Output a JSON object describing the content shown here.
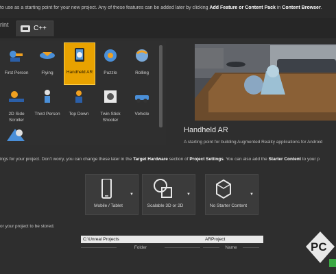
{
  "header": {
    "intro_prefix": "to use as a starting point for your new project.  Any of these features can be added later by clicking ",
    "add_feature": "Add Feature or Content Pack",
    "intro_mid": " in ",
    "content_browser": "Content Browser",
    "intro_suffix": "."
  },
  "tabs": {
    "blueprint_partial": "rint",
    "cpp": "C++"
  },
  "templates": [
    {
      "label": "First Person",
      "icon": "first-person-icon"
    },
    {
      "label": "Flying",
      "icon": "flying-icon"
    },
    {
      "label": "Handheld AR",
      "icon": "handheld-ar-icon",
      "selected": true
    },
    {
      "label": "Puzzle",
      "icon": "puzzle-icon"
    },
    {
      "label": "Rolling",
      "icon": "rolling-icon"
    },
    {
      "label": "2D Side Scroller",
      "icon": "side-scroller-icon"
    },
    {
      "label": "Third Person",
      "icon": "third-person-icon"
    },
    {
      "label": "Top Down",
      "icon": "top-down-icon"
    },
    {
      "label": "Twin Stick Shooter",
      "icon": "twin-stick-icon"
    },
    {
      "label": "Vehicle",
      "icon": "vehicle-icon"
    }
  ],
  "description": {
    "title": "Handheld AR",
    "text": "A starting point for building Augmented Reality applications for Android"
  },
  "settings": {
    "p1": "ings for your project.  Don't worry, you can change these later in the ",
    "b1": "Target Hardware",
    "p2": " section of ",
    "b2": "Project Settings",
    "p3": ".  You can also add the ",
    "b3": "Starter Content",
    "p4": " to your p"
  },
  "options": [
    {
      "label": "Mobile / Tablet",
      "icon": "mobile-tablet-icon"
    },
    {
      "label": "Scalable 3D or 2D",
      "icon": "scalable-quality-icon"
    },
    {
      "label": "No Starter Content",
      "icon": "no-starter-content-icon"
    }
  ],
  "location": {
    "instructions": "or your project to be stored.",
    "folder_value": "C:\\Unreal Projects",
    "folder_label": "Folder",
    "name_value": "ARProject",
    "name_label": "Name"
  },
  "watermark": {
    "text": "PC"
  },
  "colors": {
    "accent": "#e8a200",
    "background": "#2e2e2e",
    "panel": "#3b3b3b"
  }
}
